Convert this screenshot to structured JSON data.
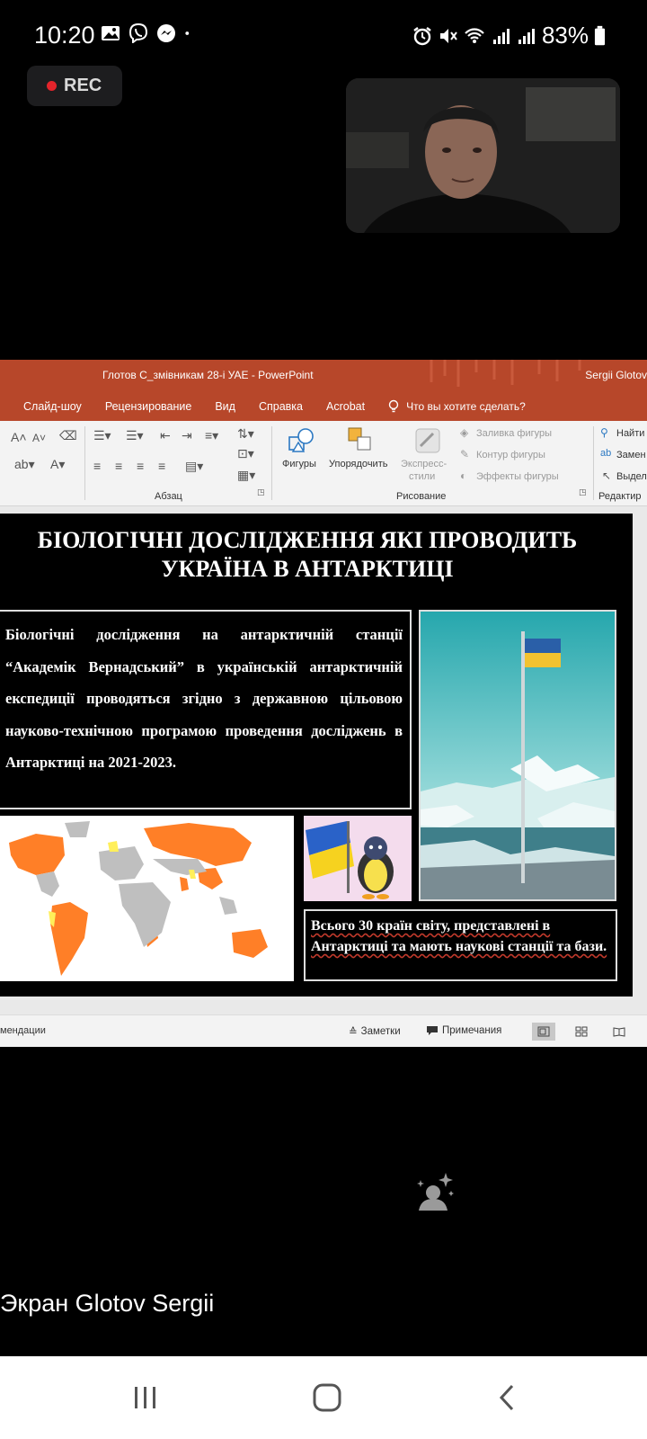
{
  "status_bar": {
    "time": "10:20",
    "battery": "83%",
    "left_icons": [
      "image-icon",
      "viber-icon",
      "messenger-icon",
      "dot-icon"
    ],
    "right_icons": [
      "alarm-icon",
      "mute-icon",
      "wifi-icon",
      "signal-icon",
      "signal-icon",
      "battery-icon"
    ]
  },
  "recording": {
    "label": "REC",
    "color": "#e3242b"
  },
  "shared_screen": {
    "window_title": "Глотов С_змівникам 28-і УАЕ  -  PowerPoint",
    "user_name": "Sergii Glotov",
    "accent": "#b7472a",
    "menu": [
      "Слайд-шоу",
      "Рецензирование",
      "Вид",
      "Справка",
      "Acrobat"
    ],
    "tell_me": "Что вы хотите сделать?",
    "ribbon": {
      "paragraph_group": "Абзац",
      "drawing_group": "Рисование",
      "editing_group": "Редактир",
      "shapes": "Фигуры",
      "arrange": "Упорядочить",
      "quick_styles_1": "Экспресс-",
      "quick_styles_2": "стили",
      "shape_fill": "Заливка фигуры",
      "shape_outline": "Контур фигуры",
      "shape_effects": "Эффекты фигуры",
      "find": "Найти",
      "replace": "Замен",
      "select": "Выдел"
    },
    "slide": {
      "title_line1": "БІОЛОГІЧНІ ДОСЛІДЖЕННЯ ЯКІ ПРОВОДИТЬ",
      "title_line2": "УКРАЇНА В АНТАРКТИЦІ",
      "body": "Біологічні дослідження на антарктичній станції “Академік Вернадський” в українській антарктичній експедиції проводяться згідно з державною цільовою науково-технічною програмою проведення досліджень в Антарктиці на 2021-2023.",
      "caption": "Всього 30 країн світу, представлені в Антарктиці та мають наукові станції та бази."
    },
    "status": {
      "left": "мендации",
      "notes": "Заметки",
      "comments": "Примечания"
    }
  },
  "screen_label": "Экран Glotov Sergii",
  "nav": [
    "recent-apps-button",
    "home-button",
    "back-button"
  ]
}
